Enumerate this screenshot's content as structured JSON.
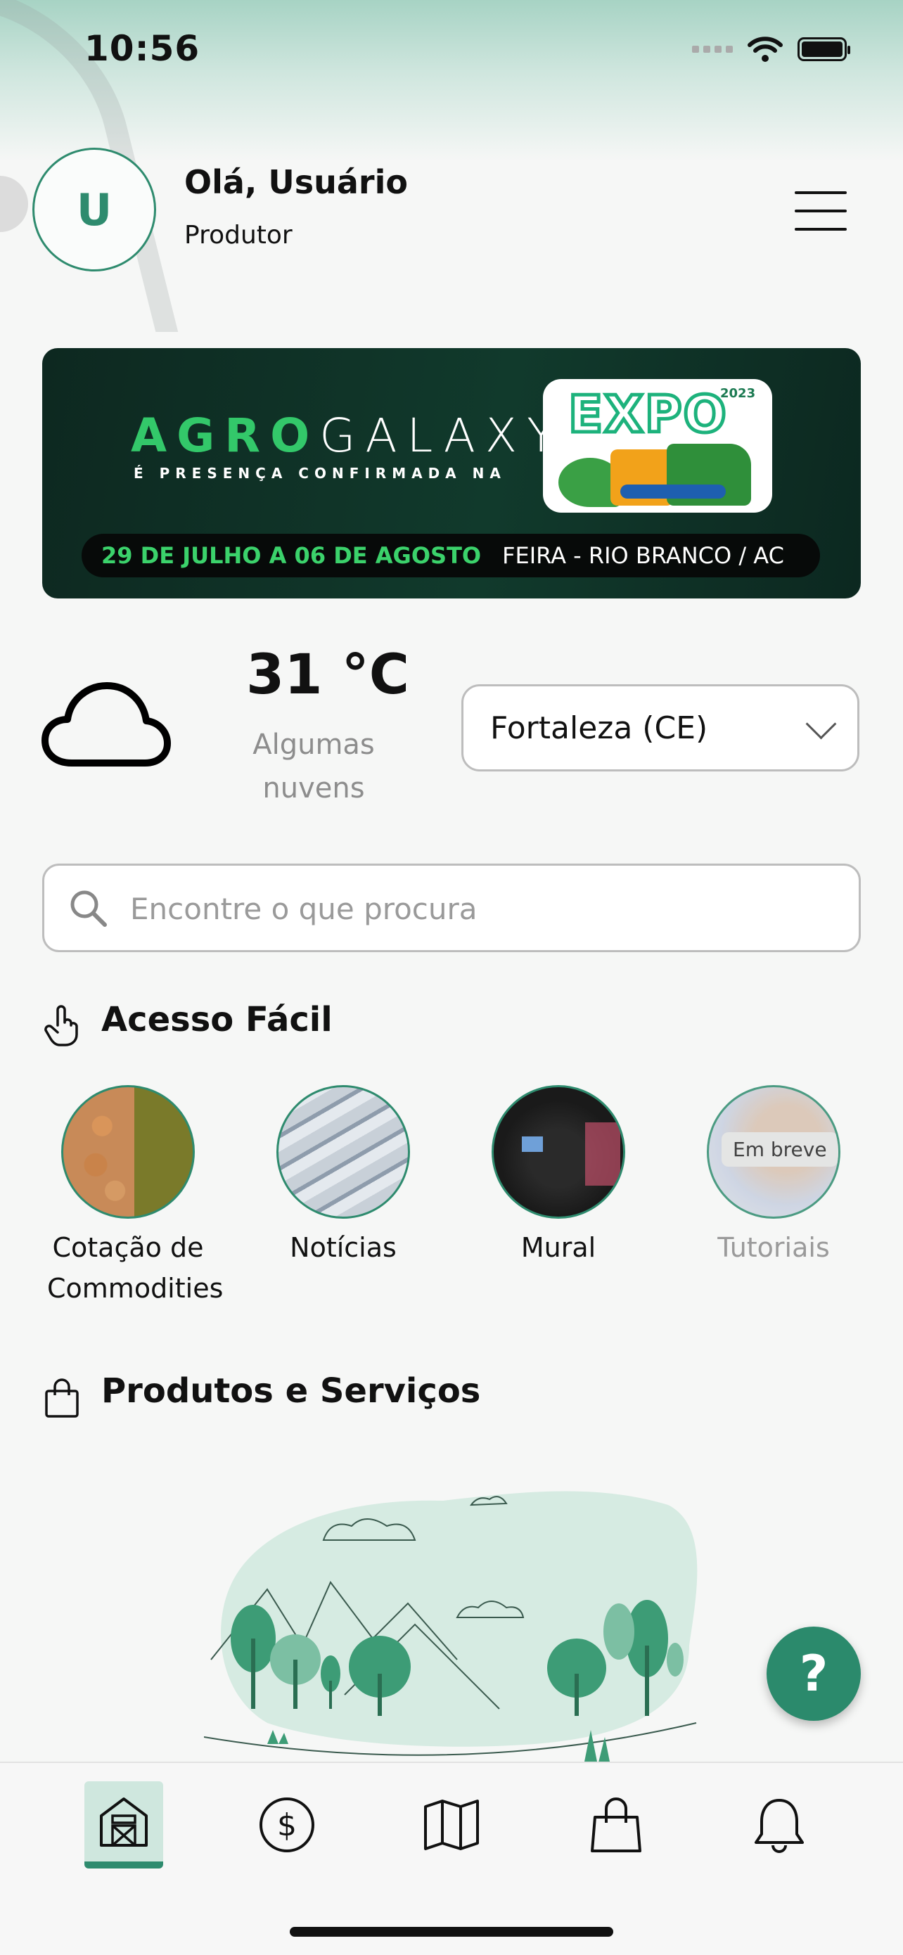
{
  "status_bar": {
    "time": "10:56"
  },
  "header": {
    "avatar_initial": "U",
    "greeting": "Olá, Usuário",
    "role": "Produtor",
    "menu_icon": "hamburger-menu-icon"
  },
  "banner": {
    "brand_green": "AGRO",
    "brand_white": "GALAXY",
    "subtitle": "É PRESENÇA CONFIRMADA NA",
    "expo_title": "EXPO",
    "expo_year": "2023",
    "dates": "29 DE JULHO A 06 DE AGOSTO",
    "location": "FEIRA - RIO BRANCO / AC"
  },
  "weather": {
    "icon": "cloud-icon",
    "temperature": "31 °C",
    "condition": "Algumas nuvens",
    "city_selected": "Fortaleza (CE)"
  },
  "search": {
    "placeholder": "Encontre o que procura",
    "value": ""
  },
  "quick_access": {
    "title": "Acesso Fácil",
    "icon": "hand-pointer-icon",
    "items": [
      {
        "label": "Cotação de Commodities",
        "enabled": true
      },
      {
        "label": "Notícias",
        "enabled": true
      },
      {
        "label": "Mural",
        "enabled": true
      },
      {
        "label": "Tutoriais",
        "enabled": false,
        "badge": "Em breve"
      }
    ]
  },
  "products": {
    "title": "Produtos e Serviços",
    "icon": "shopping-bag-icon"
  },
  "help_button": {
    "label": "?"
  },
  "tab_bar": {
    "active_index": 0,
    "items": [
      {
        "icon": "barn-icon"
      },
      {
        "icon": "dollar-icon"
      },
      {
        "icon": "map-icon"
      },
      {
        "icon": "shopping-bag-icon"
      },
      {
        "icon": "bell-icon"
      }
    ]
  },
  "colors": {
    "accent": "#2e8b6e",
    "banner_green": "#3bd26b",
    "muted": "#9a9a9a"
  }
}
